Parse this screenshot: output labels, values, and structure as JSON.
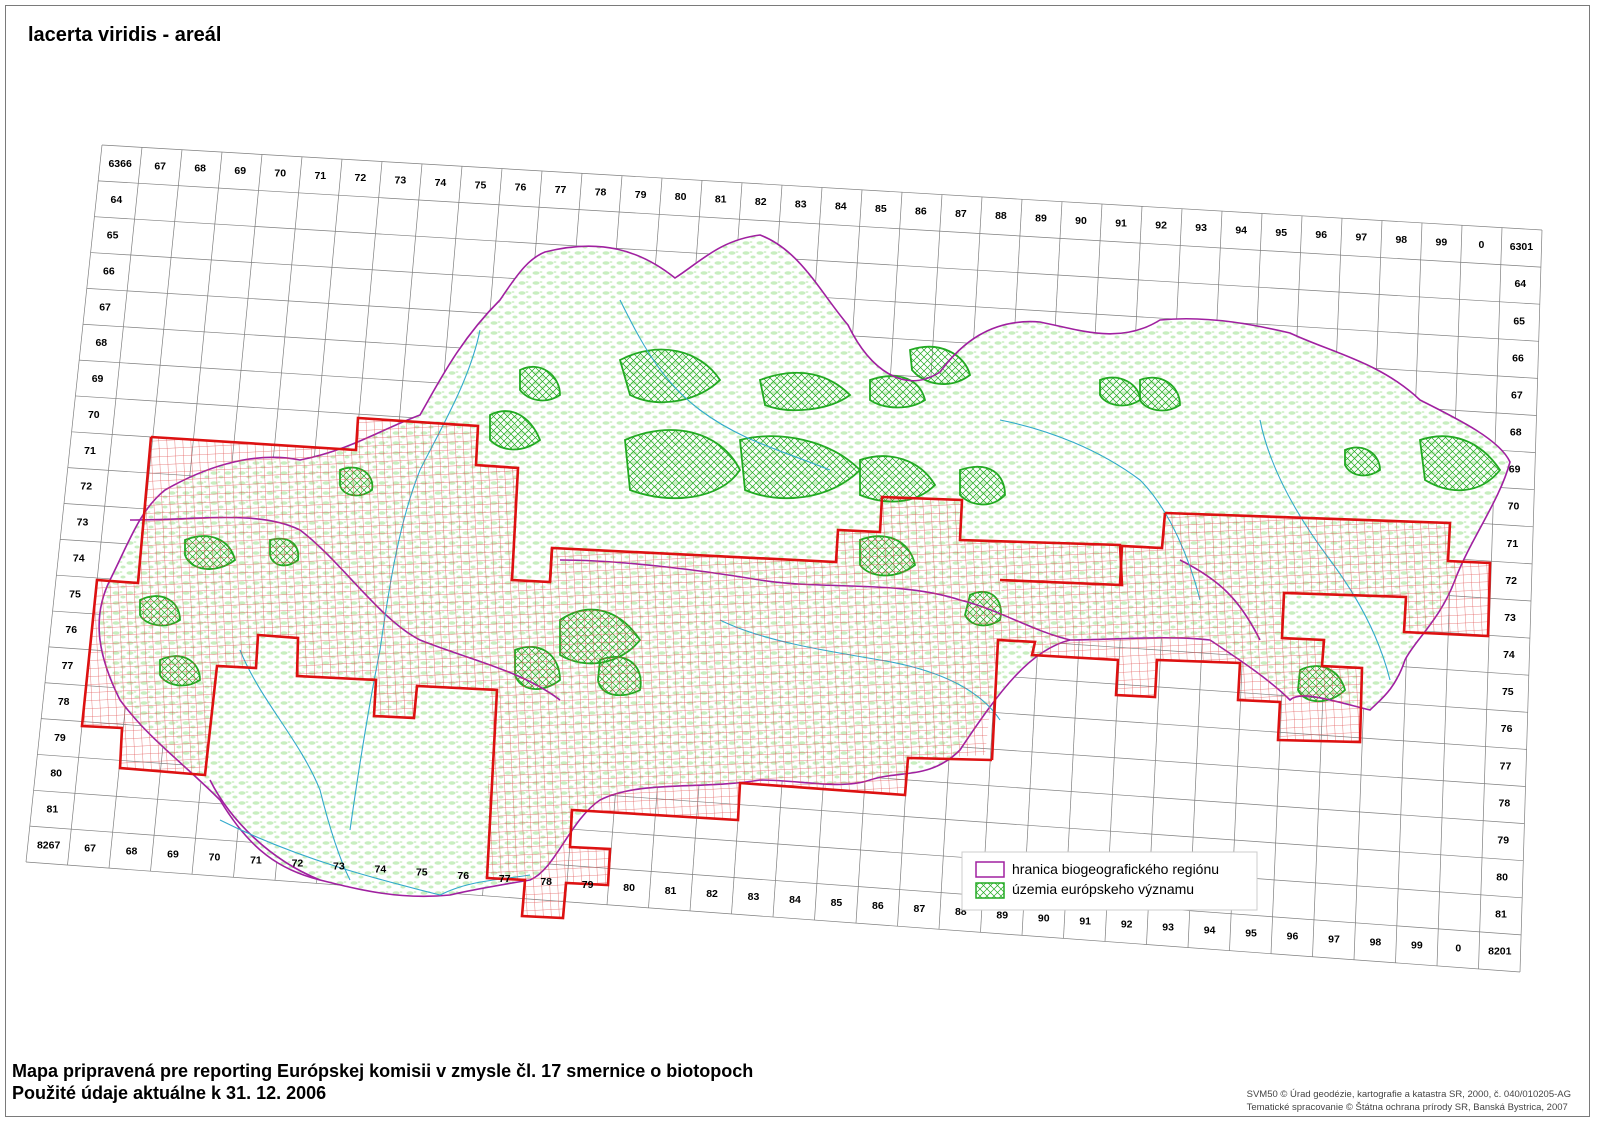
{
  "map": {
    "title": "lacerta viridis - areál",
    "footer": {
      "line1": "Mapa pripravená pre reporting Európskej komisii v zmysle čl. 17 smernice o biotopoch",
      "line2": "Použité údaje aktuálne k 31. 12. 2006"
    },
    "credits": {
      "line1": "SVM50 © Úrad geodézie, kartografie a katastra SR, 2000, č. 040/010205-AG",
      "line2": "Tematické spracovanie © Štátna ochrana prírody SR, Banská Bystrica, 2007"
    },
    "legend": {
      "items": [
        {
          "label": "hranica biogeografického regiónu",
          "color": "#a020a0"
        },
        {
          "label": "územia európskeho významu",
          "color": "#22aa22"
        }
      ]
    },
    "grid": {
      "top_labels": [
        "6366",
        "67",
        "68",
        "69",
        "70",
        "71",
        "72",
        "73",
        "74",
        "75",
        "76",
        "77",
        "78",
        "79",
        "80",
        "81",
        "82",
        "83",
        "84",
        "85",
        "86",
        "87",
        "88",
        "89",
        "90",
        "91",
        "92",
        "93",
        "94",
        "95",
        "96",
        "97",
        "98",
        "99",
        "0",
        "6301"
      ],
      "bottom_labels": [
        "8267",
        "67",
        "68",
        "69",
        "70",
        "71",
        "72",
        "73",
        "74",
        "75",
        "76",
        "77",
        "78",
        "79",
        "80",
        "81",
        "82",
        "83",
        "84",
        "85",
        "86",
        "87",
        "88",
        "89",
        "90",
        "91",
        "92",
        "93",
        "94",
        "95",
        "96",
        "97",
        "98",
        "99",
        "0",
        "8201"
      ],
      "left_labels": [
        "64",
        "65",
        "66",
        "67",
        "68",
        "69",
        "70",
        "71",
        "72",
        "73",
        "74",
        "75",
        "76",
        "77",
        "78",
        "79",
        "80",
        "81"
      ],
      "right_labels": [
        "64",
        "65",
        "66",
        "67",
        "68",
        "69",
        "70",
        "71",
        "72",
        "73",
        "74",
        "75",
        "76",
        "77",
        "78",
        "79",
        "80",
        "81"
      ]
    },
    "colors": {
      "grid_line": "#7f7f7f",
      "range_outline": "#dd1111",
      "range_hatch": "#e05050",
      "region_boundary": "#a020a0",
      "protected_sites": "#22aa22",
      "landcover": "#c8eec0",
      "rivers": "#33aacc"
    }
  }
}
